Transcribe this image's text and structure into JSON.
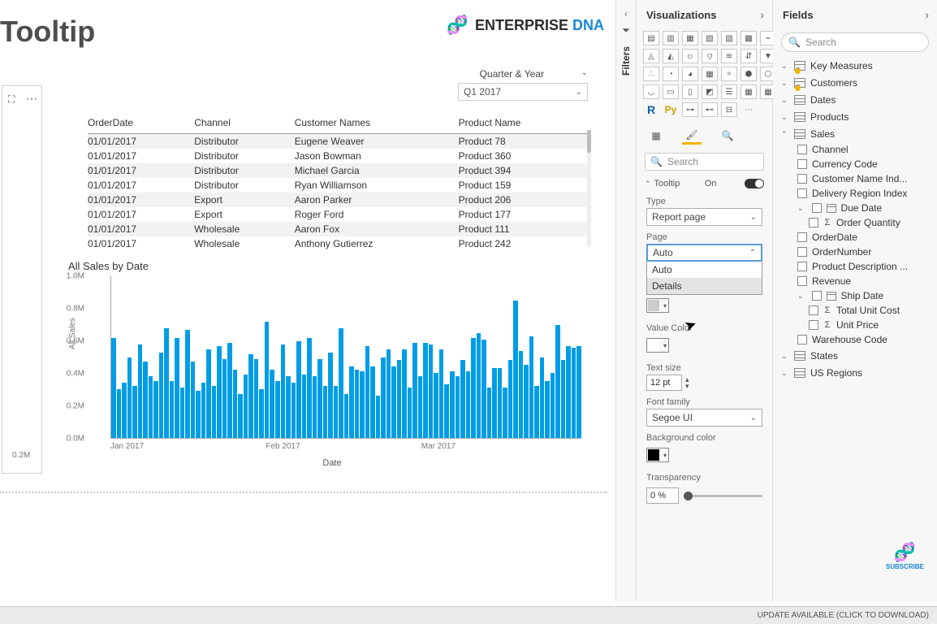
{
  "page_title": "Tooltip",
  "brand": {
    "name": "ENTERPRISE",
    "suffix": "DNA"
  },
  "slicer": {
    "label": "Quarter & Year",
    "value": "Q1 2017"
  },
  "selector_y": "0.2M",
  "table": {
    "columns": [
      "OrderDate",
      "Channel",
      "Customer Names",
      "Product Name"
    ],
    "rows": [
      [
        "01/01/2017",
        "Distributor",
        "Eugene Weaver",
        "Product 78"
      ],
      [
        "01/01/2017",
        "Distributor",
        "Jason Bowman",
        "Product 360"
      ],
      [
        "01/01/2017",
        "Distributor",
        "Michael Garcia",
        "Product 394"
      ],
      [
        "01/01/2017",
        "Distributor",
        "Ryan Williamson",
        "Product 159"
      ],
      [
        "01/01/2017",
        "Export",
        "Aaron Parker",
        "Product 206"
      ],
      [
        "01/01/2017",
        "Export",
        "Roger Ford",
        "Product 177"
      ],
      [
        "01/01/2017",
        "Wholesale",
        "Aaron Fox",
        "Product 111"
      ],
      [
        "01/01/2017",
        "Wholesale",
        "Anthony Gutierrez",
        "Product 242"
      ]
    ]
  },
  "chart_data": {
    "type": "bar",
    "title": "All Sales by Date",
    "ylabel": "All Sales",
    "xlabel": "Date",
    "ylim": [
      0,
      1.0
    ],
    "y_unit": "M",
    "y_ticks": [
      "1.0M",
      "0.8M",
      "0.6M",
      "0.4M",
      "0.2M",
      "0.0M"
    ],
    "x_ticks": [
      "Jan 2017",
      "Feb 2017",
      "Mar 2017"
    ],
    "values": [
      0.62,
      0.3,
      0.34,
      0.5,
      0.32,
      0.58,
      0.47,
      0.38,
      0.35,
      0.53,
      0.68,
      0.35,
      0.62,
      0.31,
      0.67,
      0.47,
      0.29,
      0.34,
      0.55,
      0.32,
      0.57,
      0.49,
      0.59,
      0.42,
      0.27,
      0.39,
      0.52,
      0.49,
      0.3,
      0.72,
      0.42,
      0.35,
      0.58,
      0.38,
      0.34,
      0.6,
      0.39,
      0.62,
      0.38,
      0.49,
      0.32,
      0.53,
      0.32,
      0.68,
      0.27,
      0.44,
      0.42,
      0.41,
      0.57,
      0.44,
      0.26,
      0.5,
      0.55,
      0.44,
      0.48,
      0.55,
      0.31,
      0.59,
      0.38,
      0.59,
      0.58,
      0.4,
      0.55,
      0.33,
      0.41,
      0.38,
      0.48,
      0.41,
      0.62,
      0.65,
      0.61,
      0.31,
      0.43,
      0.43,
      0.31,
      0.48,
      0.85,
      0.54,
      0.45,
      0.63,
      0.32,
      0.5,
      0.35,
      0.4,
      0.7,
      0.48,
      0.57,
      0.56,
      0.57
    ]
  },
  "filters": {
    "label": "Filters"
  },
  "viz": {
    "header": "Visualizations",
    "search_placeholder": "Search",
    "tooltip_section": "Tooltip",
    "tooltip_state": "On",
    "type_label": "Type",
    "type_value": "Report page",
    "page_label": "Page",
    "page_value": "Auto",
    "page_options": [
      "Auto",
      "Details"
    ],
    "value_color_label": "Value Color",
    "text_size_label": "Text size",
    "text_size_value": "12",
    "text_size_unit": "pt",
    "font_label": "Font family",
    "font_value": "Segoe UI",
    "bg_label": "Background color",
    "transparency_label": "Transparency",
    "transparency_value": "0",
    "transparency_unit": "%"
  },
  "fields": {
    "header": "Fields",
    "search_placeholder": "Search",
    "tables": [
      {
        "name": "Key Measures",
        "badge": true
      },
      {
        "name": "Customers",
        "badge": true
      },
      {
        "name": "Dates"
      },
      {
        "name": "Products"
      },
      {
        "name": "Sales",
        "expanded": true,
        "items": [
          {
            "name": "Channel"
          },
          {
            "name": "Currency Code"
          },
          {
            "name": "Customer Name Ind..."
          },
          {
            "name": "Delivery Region Index"
          },
          {
            "name": "Due Date",
            "date": true,
            "sub": true,
            "chev": true
          },
          {
            "name": "Order Quantity",
            "sigma": true,
            "sub": true
          },
          {
            "name": "OrderDate"
          },
          {
            "name": "OrderNumber"
          },
          {
            "name": "Product Description ..."
          },
          {
            "name": "Revenue"
          },
          {
            "name": "Ship Date",
            "date": true,
            "sub": true,
            "chev": true
          },
          {
            "name": "Total Unit Cost",
            "sigma": true,
            "sub": true
          },
          {
            "name": "Unit Price",
            "sigma": true,
            "sub": true
          },
          {
            "name": "Warehouse Code"
          }
        ]
      },
      {
        "name": "States"
      },
      {
        "name": "US Regions"
      }
    ]
  },
  "subscribe": "SUBSCRIBE",
  "status": "UPDATE AVAILABLE (CLICK TO DOWNLOAD)"
}
